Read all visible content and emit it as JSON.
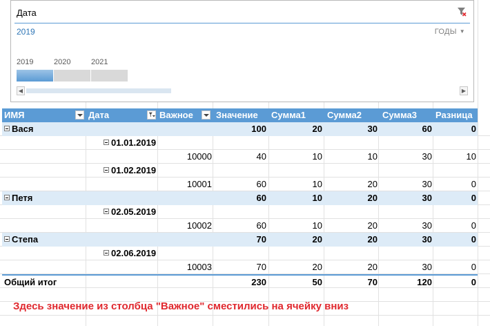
{
  "timeline": {
    "title": "Дата",
    "selected_period": "2019",
    "level": "ГОДЫ",
    "years": [
      "2019",
      "2020",
      "2021"
    ]
  },
  "pivot": {
    "headers": [
      "ИМЯ",
      "Дата",
      "Важное",
      "Значение",
      "Сумма1",
      "Сумма2",
      "Сумма3",
      "Разница"
    ],
    "rows": [
      {
        "type": "group",
        "name": "Вася",
        "value": "100",
        "s1": "20",
        "s2": "30",
        "s3": "60",
        "diff": "0"
      },
      {
        "type": "date",
        "date": "01.01.2019"
      },
      {
        "type": "detail",
        "important": "10000",
        "value": "40",
        "s1": "10",
        "s2": "10",
        "s3": "30",
        "diff": "10"
      },
      {
        "type": "date",
        "date": "01.02.2019"
      },
      {
        "type": "detail",
        "important": "10001",
        "value": "60",
        "s1": "10",
        "s2": "20",
        "s3": "30",
        "diff": "0"
      },
      {
        "type": "group",
        "name": "Петя",
        "value": "60",
        "s1": "10",
        "s2": "20",
        "s3": "30",
        "diff": "0"
      },
      {
        "type": "date",
        "date": "02.05.2019"
      },
      {
        "type": "detail",
        "important": "10002",
        "value": "60",
        "s1": "10",
        "s2": "20",
        "s3": "30",
        "diff": "0"
      },
      {
        "type": "group",
        "name": "Степа",
        "value": "70",
        "s1": "20",
        "s2": "20",
        "s3": "30",
        "diff": "0"
      },
      {
        "type": "date",
        "date": "02.06.2019"
      },
      {
        "type": "detail",
        "important": "10003",
        "value": "70",
        "s1": "20",
        "s2": "20",
        "s3": "30",
        "diff": "0"
      }
    ],
    "total": {
      "label": "Общий итог",
      "value": "230",
      "s1": "50",
      "s2": "70",
      "s3": "120",
      "diff": "0"
    }
  },
  "note": "Здесь значение из столбца \"Важное\" сместились на ячейку вниз",
  "colors": {
    "header": "#5b9bd5",
    "group_row": "#ddebf7",
    "note": "#e0282e",
    "timeline_selected": "#2e75b6"
  }
}
